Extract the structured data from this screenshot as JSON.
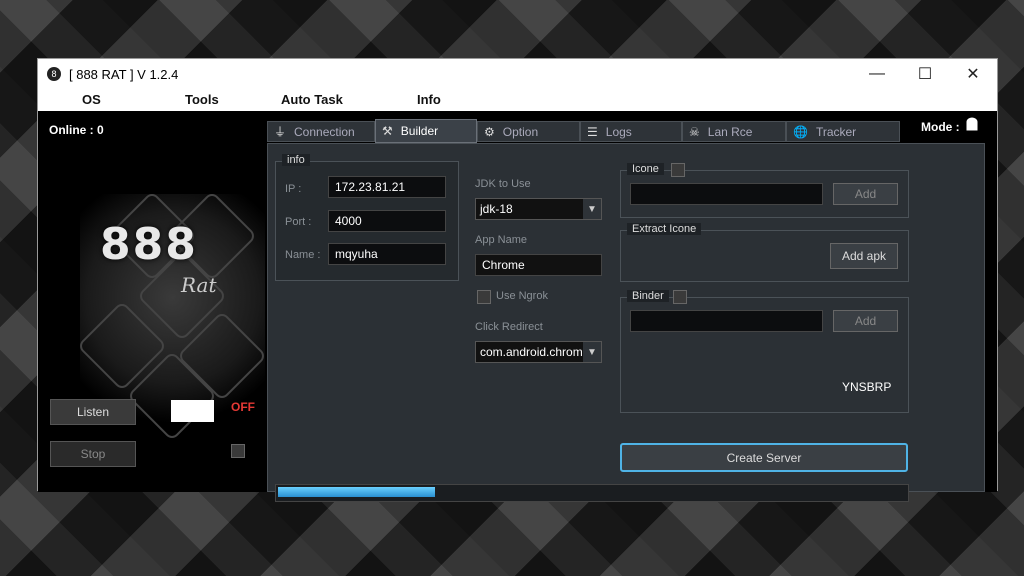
{
  "window": {
    "title": "[  888 RAT  ] V 1.2.4",
    "app_icon": "8",
    "controls": {
      "minimize": "—",
      "maximize": "☐",
      "close": "✕"
    }
  },
  "menu": [
    "OS",
    "Tools",
    "Auto Task",
    "Info"
  ],
  "status": {
    "online": "Online : 0",
    "mode_label": "Mode :",
    "mode_icon": "android-icon",
    "listen_state": "OFF",
    "listen_state_color": "#e53935"
  },
  "logo": {
    "big": "888",
    "small": "Rat"
  },
  "buttons": {
    "listen": "Listen",
    "stop": "Stop"
  },
  "tabs": [
    {
      "label": "Connection",
      "icon": "plug-icon",
      "glyph": "⏚",
      "active": false
    },
    {
      "label": "Builder",
      "icon": "tools-icon",
      "glyph": "⚒",
      "active": true
    },
    {
      "label": "Option",
      "icon": "gear-icon",
      "glyph": "⚙",
      "active": false
    },
    {
      "label": "Logs",
      "icon": "logs-icon",
      "glyph": "☰",
      "active": false
    },
    {
      "label": "Lan Rce",
      "icon": "skull-icon",
      "glyph": "☠",
      "active": false
    },
    {
      "label": "Tracker",
      "icon": "globe-icon",
      "glyph": "🌐",
      "active": false
    }
  ],
  "builder": {
    "info_title": "info",
    "ip_label": "IP :",
    "ip_value": "172.23.81.21",
    "port_label": "Port :",
    "port_value": "4000",
    "name_label": "Name :",
    "name_value": "mqyuha",
    "jdk_label": "JDK to Use",
    "jdk_value": "jdk-18",
    "app_name_label": "App Name",
    "app_name_value": "Chrome",
    "use_ngrok_label": "Use Ngrok",
    "click_redirect_label": "Click Redirect",
    "click_redirect_value": "com.android.chrome",
    "icone_title": "Icone",
    "icone_add": "Add",
    "extract_title": "Extract Icone",
    "add_apk": "Add apk",
    "binder_title": "Binder",
    "binder_add": "Add",
    "binder_code": "YNSBRP",
    "create_server": "Create Server",
    "progress_fraction": 0.25
  }
}
